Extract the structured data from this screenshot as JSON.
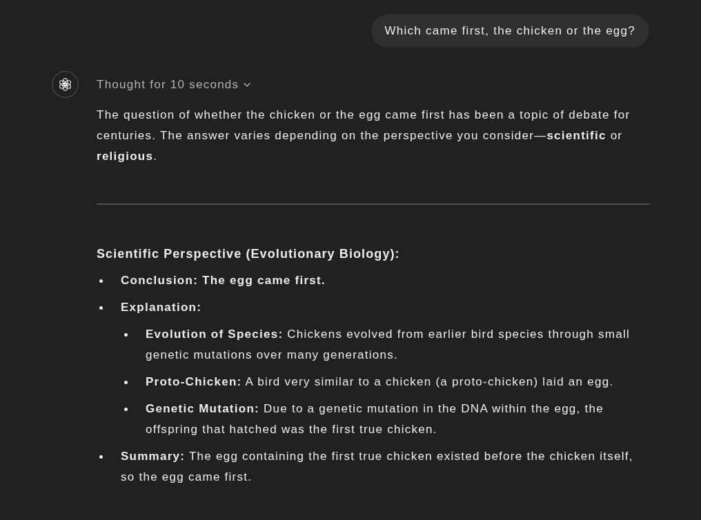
{
  "user_message": {
    "text": "Which came first, the chicken or the egg?"
  },
  "assistant": {
    "thought": {
      "label": "Thought for 10 seconds",
      "expanded": false
    },
    "intro": "The question of whether the chicken or the egg came first has been a topic of debate for centuries. The answer varies depending on the perspective you consider—**scientific** or **religious**.",
    "sections": [
      {
        "heading": "Scientific Perspective (Evolutionary Biology):",
        "items": [
          {
            "text": "**Conclusion: The egg came first.**"
          },
          {
            "text": "**Explanation:**",
            "children": [
              {
                "text": "**Evolution of Species:** Chickens evolved from earlier bird species through small genetic mutations over many generations."
              },
              {
                "text": "**Proto-Chicken:** A bird very similar to a chicken (a proto-chicken) laid an egg."
              },
              {
                "text": "**Genetic Mutation:** Due to a genetic mutation in the DNA within the egg, the offspring that hatched was the first true chicken."
              }
            ]
          },
          {
            "text": "**Summary:** The egg containing the first true chicken existed before the chicken itself, so the egg came first."
          }
        ]
      }
    ]
  }
}
